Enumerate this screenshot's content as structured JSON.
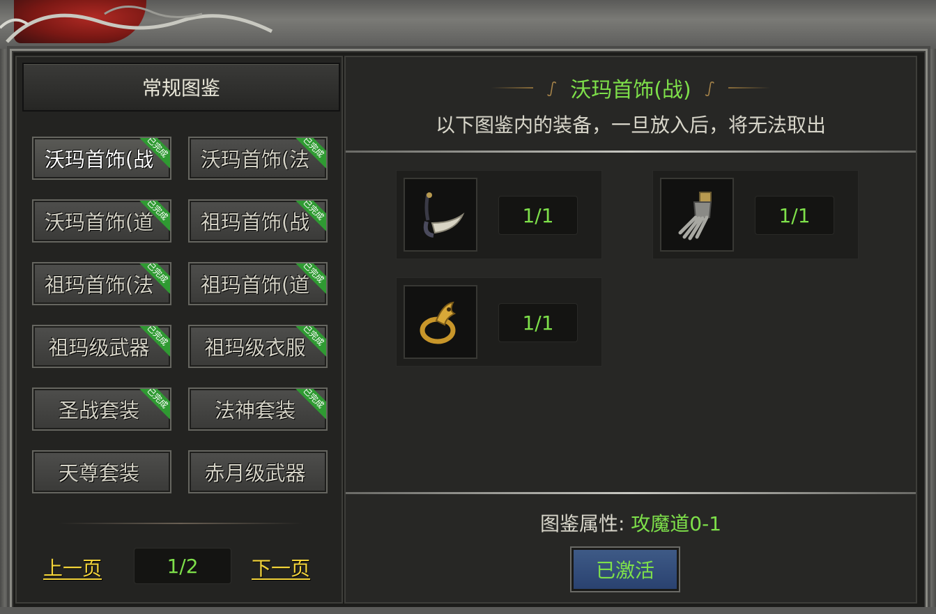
{
  "sidebar": {
    "header": "常规图鉴",
    "items": [
      {
        "label": "沃玛首饰(战",
        "badge": "已完成",
        "selected": true
      },
      {
        "label": "沃玛首饰(法",
        "badge": "已完成"
      },
      {
        "label": "沃玛首饰(道",
        "badge": "已完成"
      },
      {
        "label": "祖玛首饰(战",
        "badge": "已完成"
      },
      {
        "label": "祖玛首饰(法",
        "badge": "已完成"
      },
      {
        "label": "祖玛首饰(道",
        "badge": "已完成"
      },
      {
        "label": "祖玛级武器",
        "badge": "已完成"
      },
      {
        "label": "祖玛级衣服",
        "badge": "已完成"
      },
      {
        "label": "圣战套装",
        "badge": "已完成"
      },
      {
        "label": "法神套装",
        "badge": "已完成"
      },
      {
        "label": "天尊套装",
        "badge": ""
      },
      {
        "label": "赤月级武器",
        "badge": ""
      }
    ],
    "pager": {
      "prev": "上一页",
      "page": "1/2",
      "next": "下一页"
    }
  },
  "detail": {
    "title": "沃玛首饰(战)",
    "subtitle": "以下图鉴内的装备，一旦放入后，将无法取出",
    "slots": [
      {
        "icon": "tooth-necklace-icon",
        "count": "1/1"
      },
      {
        "icon": "gauntlet-icon",
        "count": "1/1"
      },
      {
        "icon": "dragon-ring-icon",
        "count": "1/1"
      }
    ],
    "attr_label": "图鉴属性:",
    "attr_value": "攻魔道0-1",
    "activate_label": "已激活"
  },
  "colors": {
    "highlight_green": "#7ee04a",
    "link_yellow": "#f3d43a",
    "badge_green": "#2f9a32",
    "button_blue": "#2a4270"
  }
}
